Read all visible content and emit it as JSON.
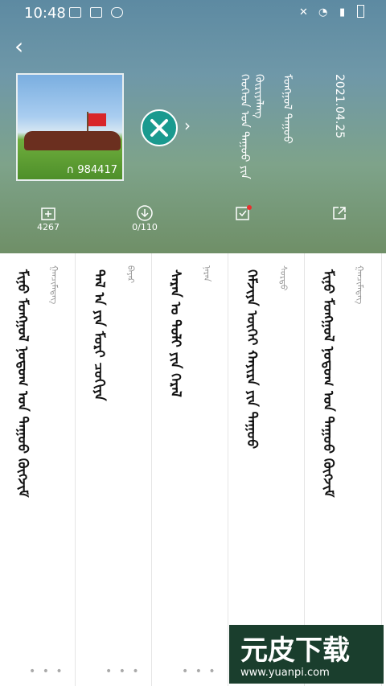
{
  "status": {
    "time": "10:48"
  },
  "album": {
    "plays": "984417",
    "date": "2021.04.25",
    "title_mong": "ᠬᠡᠦᠬᠡᠳ ᠤᠨ ᠳᠠᠭᠤᠤ ᠶᠢᠨ ᠬᠦᠷᠢᠶᠡᠯᠡᠩ",
    "subtitle_mong": "ᠮᠣᠩᠭᠣᠯ ᠳᠠᠭᠤᠤ"
  },
  "actions": [
    {
      "icon": "add-folder-icon",
      "label": "4267"
    },
    {
      "icon": "download-icon",
      "label": "0/110"
    },
    {
      "icon": "checklist-icon",
      "label": ""
    },
    {
      "icon": "share-icon",
      "label": ""
    }
  ],
  "cards": [
    {
      "title": "ᠮᠢᠨᠦ ᠮᠣᠩᠭᠣᠯ ᠨᠤᠲᠤᠭ ᠤᠨ ᠳᠠᠭᠤᠤ ᠬᠥᠭᠵᠢᠮ",
      "sub": "ᠭᠠᠨᠴᠢᠮᠡᠳᠡᠭ",
      "more": "• • •"
    },
    {
      "title": "ᠲᠠᠯ ᠠ ᠶᠢᠨ ᠮᠣᠷᠢ ᠴᠣᠬᠢᠶᠠ",
      "sub": "ᠪᠠᠶᠠᠷ",
      "more": "• • •"
    },
    {
      "title": "ᠰᠠᠷᠠᠨ ᠤ ᠲᠣᠯᠢ ᠶᠢᠨ ᠭᠡᠷᠡᠯ",
      "sub": "ᠨᠠᠷᠠᠨ",
      "more": "• • •"
    },
    {
      "title": "ᠬᠡᠮᠵᠢᠶᠡ ᠦᠭᠡᠢ ᠬᠠᠶᠢᠷᠠ ᠶᠢᠨ ᠳᠠᠭᠤᠤ",
      "sub": "ᠰᠤᠷᠲᠤ",
      "more": "• • •"
    },
    {
      "title": "ᠮᠢᠨᠦ ᠮᠣᠩᠭᠣᠯ ᠨᠤᠲᠤᠭ ᠤᠨ ᠳᠠᠭᠤᠤ ᠬᠥᠭᠵᠢᠮ",
      "sub": "ᠭᠠᠨᠴᠢᠮᠡᠳᠡᠭ",
      "more": "• • •"
    }
  ],
  "watermark": {
    "name": "元皮下载",
    "url": "www.yuanpi.com"
  }
}
